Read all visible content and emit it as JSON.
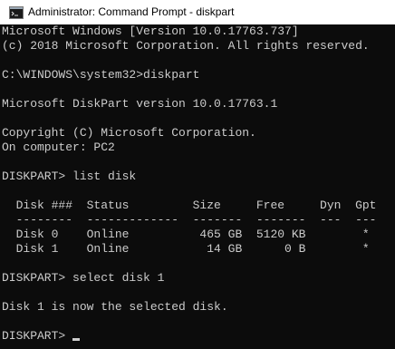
{
  "window": {
    "title": "Administrator: Command Prompt - diskpart",
    "icon": "command-prompt-icon"
  },
  "console": {
    "lines": [
      "Microsoft Windows [Version 10.0.17763.737]",
      "(c) 2018 Microsoft Corporation. All rights reserved.",
      "",
      "C:\\WINDOWS\\system32>diskpart",
      "",
      "Microsoft DiskPart version 10.0.17763.1",
      "",
      "Copyright (C) Microsoft Corporation.",
      "On computer: PC2",
      "",
      "DISKPART> list disk",
      "",
      "  Disk ###  Status         Size     Free     Dyn  Gpt",
      "  --------  -------------  -------  -------  ---  ---",
      "  Disk 0    Online          465 GB  5120 KB        *",
      "  Disk 1    Online           14 GB      0 B        *",
      "",
      "DISKPART> select disk 1",
      "",
      "Disk 1 is now the selected disk.",
      ""
    ],
    "prompt": "DISKPART> "
  },
  "colors": {
    "background": "#0c0c0c",
    "text": "#cccccc",
    "titlebar": "#ffffff"
  }
}
